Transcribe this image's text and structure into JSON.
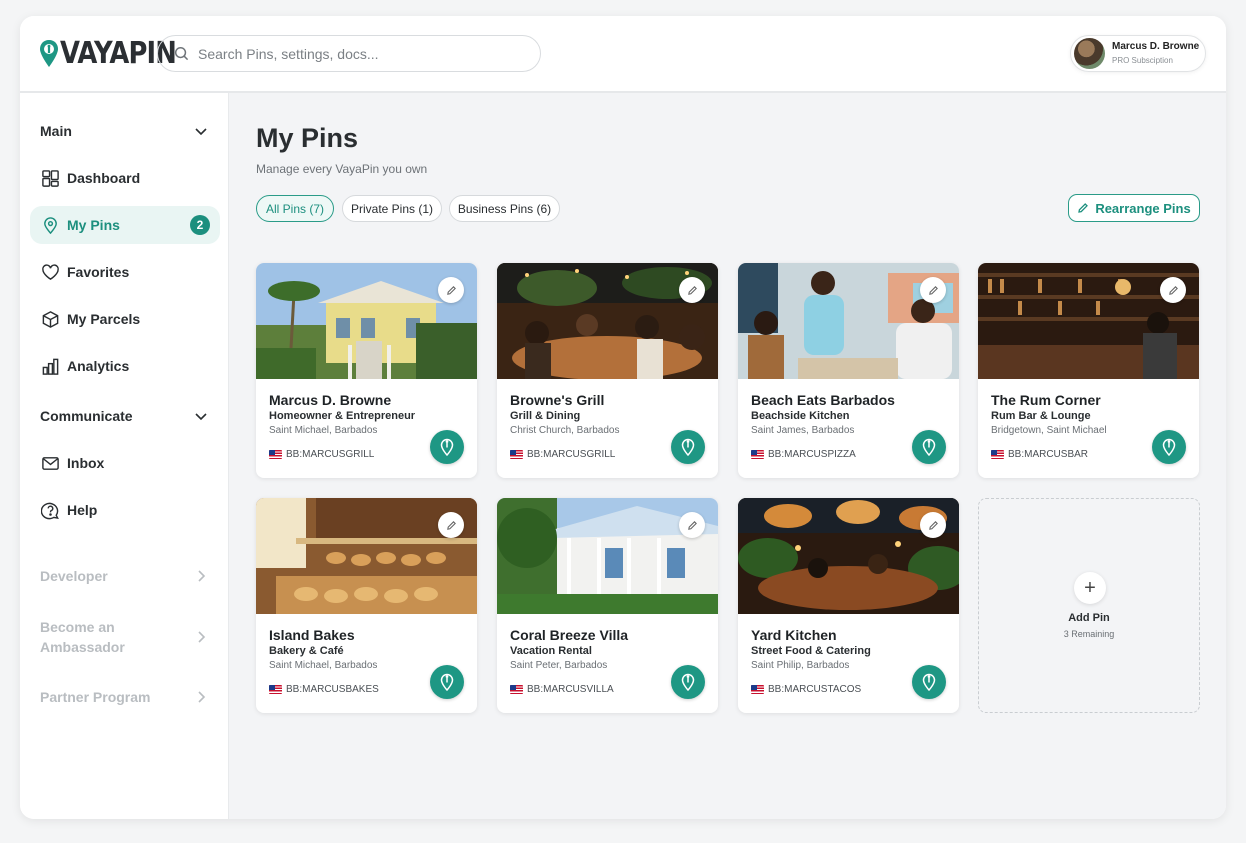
{
  "brand": {
    "name": "VAYAPIN",
    "accent": "#1c8f7e"
  },
  "search": {
    "placeholder": "Search Pins, settings, docs..."
  },
  "profile": {
    "name": "Marcus D. Browne",
    "subscription": "PRO Subsciption"
  },
  "sidebar": {
    "main_label": "Main",
    "items": [
      {
        "label": "Dashboard",
        "icon": "dashboard-icon"
      },
      {
        "label": "My Pins",
        "icon": "pin-icon",
        "badge": "2",
        "active": true
      },
      {
        "label": "Favorites",
        "icon": "heart-icon"
      },
      {
        "label": "My Parcels",
        "icon": "box-icon"
      },
      {
        "label": "Analytics",
        "icon": "bar-chart-icon"
      }
    ],
    "communicate_label": "Communicate",
    "communicate_items": [
      {
        "label": "Inbox",
        "icon": "mail-icon"
      },
      {
        "label": "Help",
        "icon": "help-icon"
      }
    ],
    "developer_label": "Developer",
    "ambassador_label": "Become an Ambassador",
    "partner_label": "Partner Program"
  },
  "page": {
    "title": "My Pins",
    "subtitle": "Manage every VayaPin you own",
    "filters": [
      {
        "label": "All Pins (7)",
        "active": true
      },
      {
        "label": "Private Pins (1)"
      },
      {
        "label": "Business Pins (6)"
      }
    ],
    "rearrange_label": "Rearrange Pins"
  },
  "pins": [
    {
      "name": "Marcus D. Browne",
      "category": "Homeowner & Entrepreneur",
      "location": "Saint Michael, Barbados",
      "code": "BB:MARCUSGRILL",
      "photo": "house"
    },
    {
      "name": "Browne's Grill",
      "category": "Grill & Dining",
      "location": "Christ Church, Barbados",
      "code": "BB:MARCUSGRILL",
      "photo": "restaurant"
    },
    {
      "name": "Beach Eats Barbados",
      "category": "Beachside Kitchen",
      "location": "Saint James, Barbados",
      "code": "BB:MARCUSPIZZA",
      "photo": "beach"
    },
    {
      "name": "The Rum Corner",
      "category": "Rum Bar & Lounge",
      "location": "Bridgetown, Saint Michael",
      "code": "BB:MARCUSBAR",
      "photo": "bar"
    },
    {
      "name": "Island Bakes",
      "category": "Bakery & Café",
      "location": "Saint Michael, Barbados",
      "code": "BB:MARCUSBAKES",
      "photo": "bakery"
    },
    {
      "name": "Coral Breeze Villa",
      "category": "Vacation Rental",
      "location": "Saint Peter, Barbados",
      "code": "BB:MARCUSVILLA",
      "photo": "villa"
    },
    {
      "name": "Yard Kitchen",
      "category": "Street Food & Catering",
      "location": "Saint Philip, Barbados",
      "code": "BB:MARCUSTACOS",
      "photo": "streetfood"
    }
  ],
  "add_pin": {
    "label": "Add Pin",
    "remaining": "3 Remaining"
  }
}
